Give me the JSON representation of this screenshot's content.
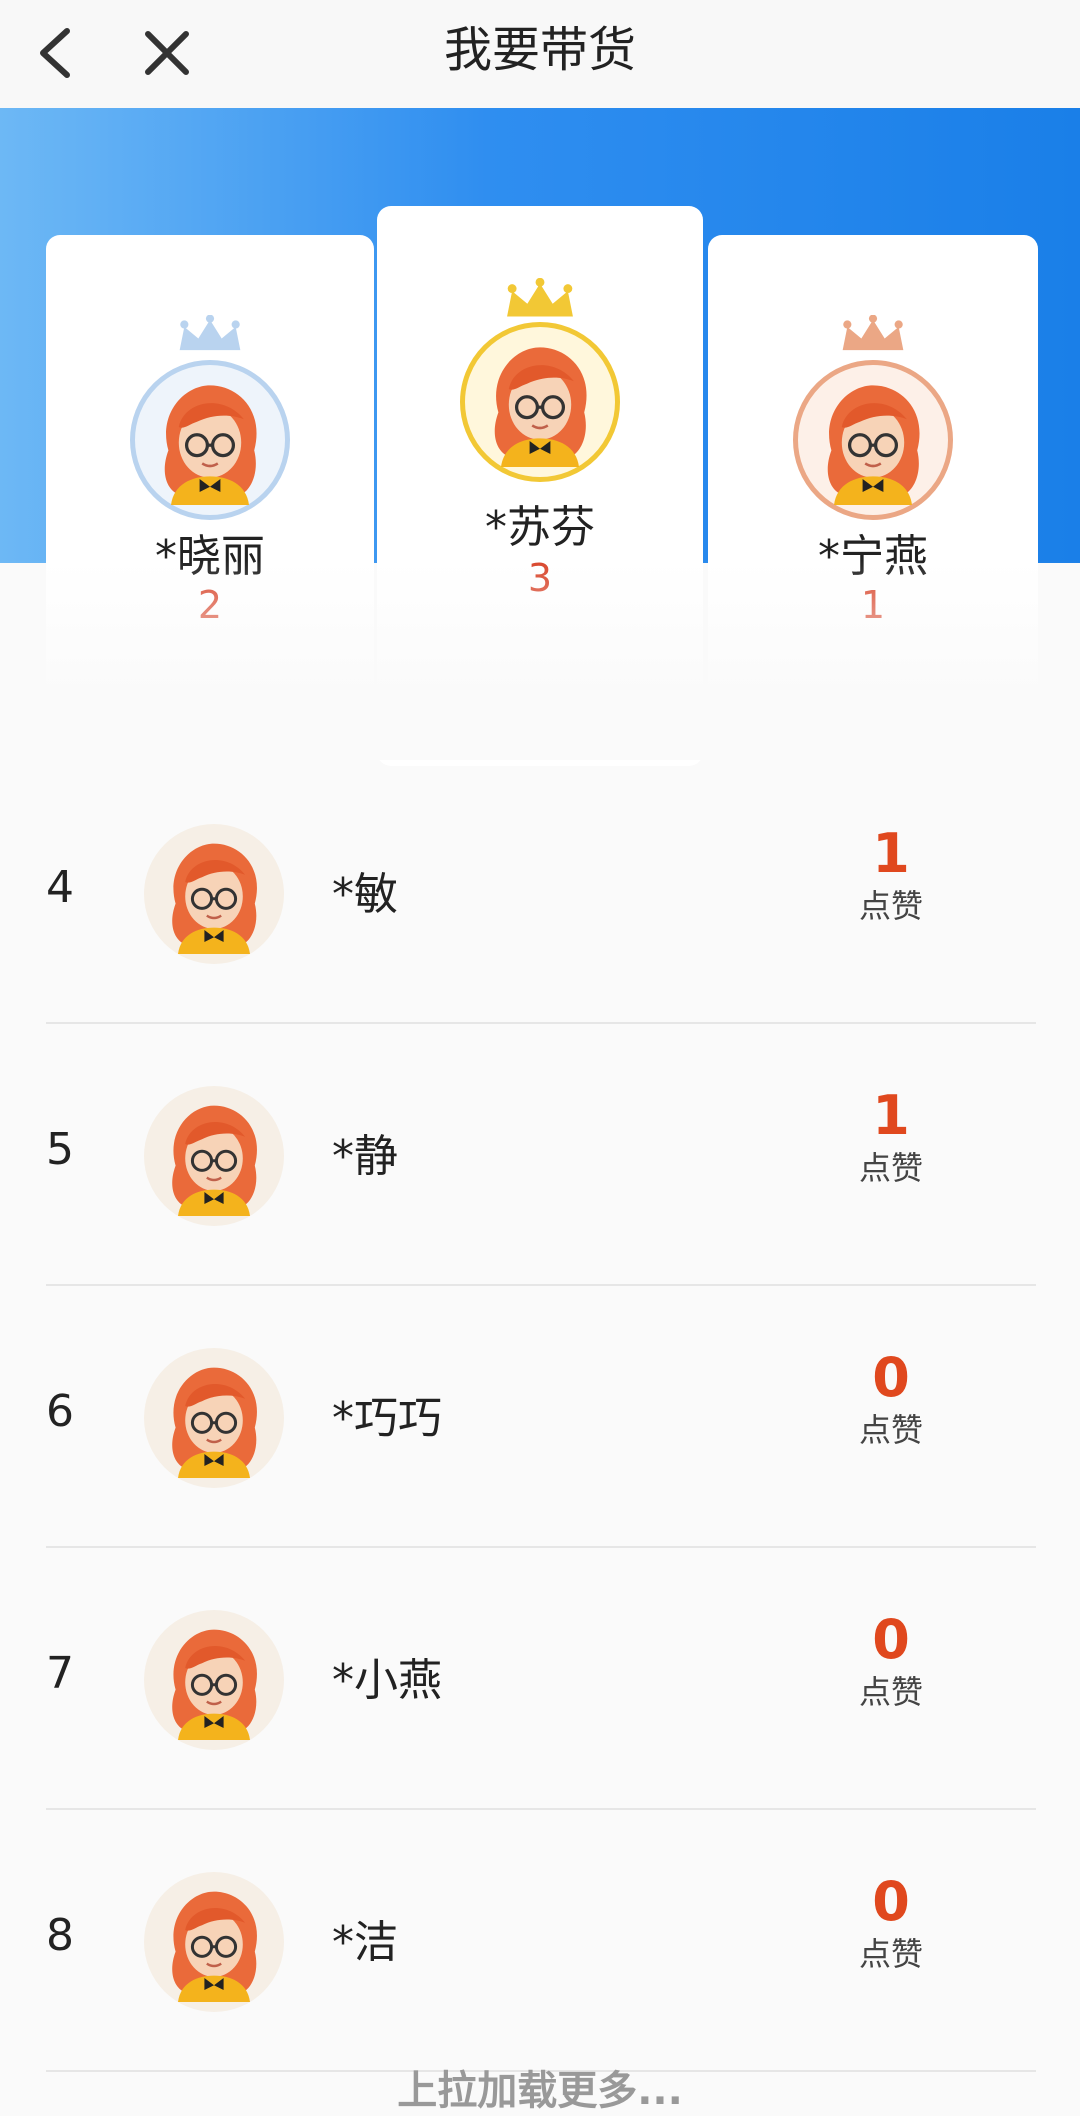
{
  "header": {
    "title": "我要带货",
    "back_icon": "chevron-left-icon",
    "close_icon": "close-icon"
  },
  "colors": {
    "banner_start": "#6db8f5",
    "banner_end": "#1a7fe8",
    "accent": "#e0481e",
    "first_ring": "#f2c835",
    "second_ring": "#b9d3ef",
    "third_ring": "#eba785"
  },
  "podium": {
    "first": {
      "name": "*苏芬",
      "count": "3"
    },
    "second": {
      "name": "*晓丽",
      "count": "2"
    },
    "third": {
      "name": "*宁燕",
      "count": "1"
    }
  },
  "ranking": [
    {
      "rank": "4",
      "name": "*敏",
      "likes": "1",
      "like_label": "点赞"
    },
    {
      "rank": "5",
      "name": "*静",
      "likes": "1",
      "like_label": "点赞"
    },
    {
      "rank": "6",
      "name": "*巧巧",
      "likes": "0",
      "like_label": "点赞"
    },
    {
      "rank": "7",
      "name": "*小燕",
      "likes": "0",
      "like_label": "点赞"
    },
    {
      "rank": "8",
      "name": "*洁",
      "likes": "0",
      "like_label": "点赞"
    }
  ],
  "footer": {
    "load_more": "上拉加载更多..."
  }
}
